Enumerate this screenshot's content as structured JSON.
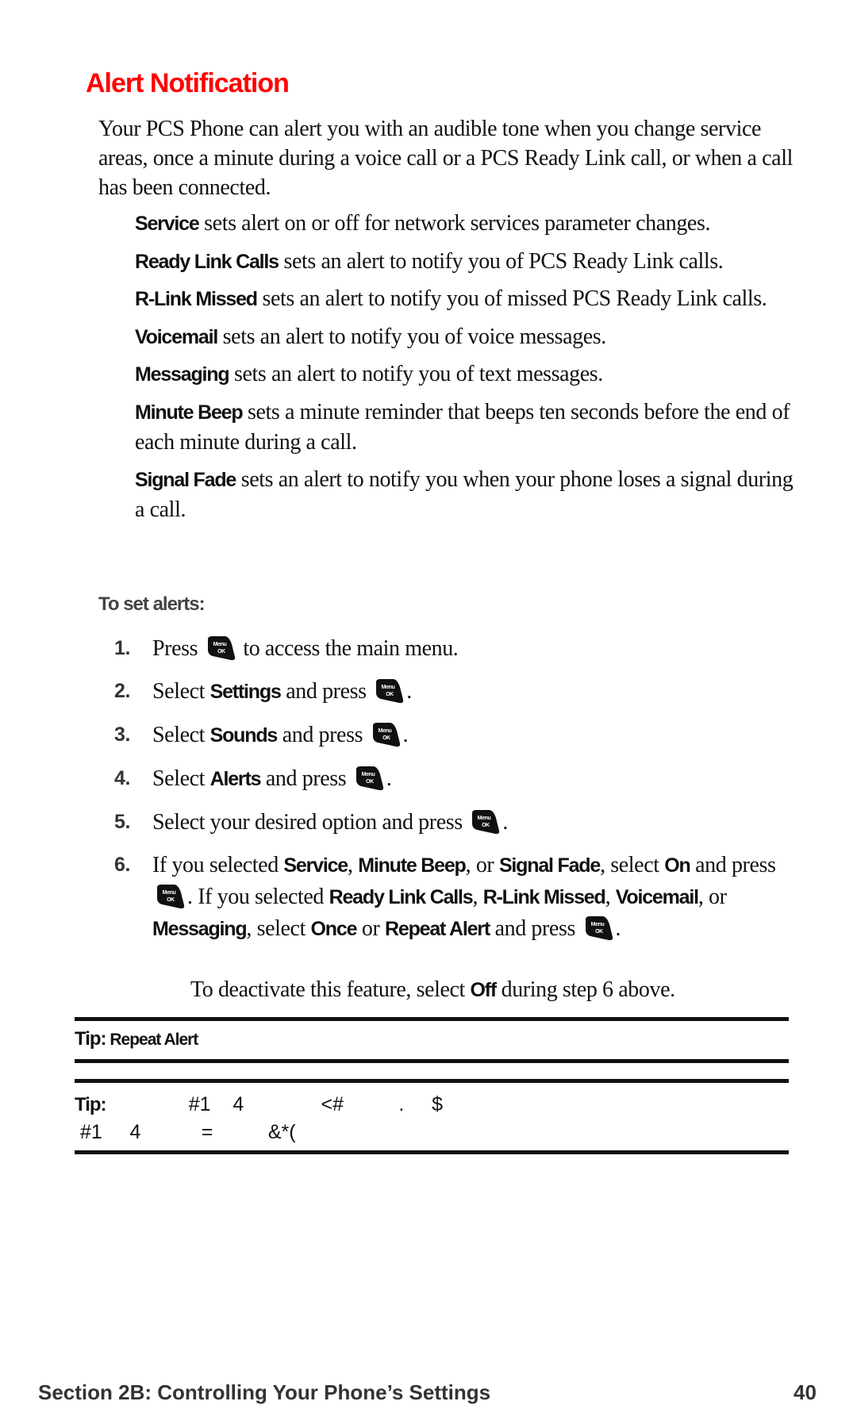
{
  "title": "Alert Notification",
  "intro": "Your PCS Phone can alert you with an audible tone when you change service areas, once a minute during a voice call or a PCS Ready Link call, or when a call has been connected.",
  "definitions": [
    {
      "term": "Service",
      "text": " sets alert on or off for network services parameter changes."
    },
    {
      "term": "Ready Link Calls",
      "text": " sets an alert to notify you of PCS Ready Link calls."
    },
    {
      "term": "R-Link Missed",
      "text": " sets an alert to notify you of missed PCS Ready Link calls."
    },
    {
      "term": "Voicemail",
      "text": " sets an alert to notify you of voice messages."
    },
    {
      "term": "Messaging",
      "text": " sets an alert to notify you of text messages."
    },
    {
      "term": "Minute Beep",
      "text": " sets a minute reminder that beeps ten seconds before the end of each minute during a call."
    },
    {
      "term": "Signal Fade",
      "text": " sets an alert to notify you when your phone loses a signal during a call."
    }
  ],
  "procedure_heading": "To set alerts:",
  "steps": {
    "s1": {
      "num": "1.",
      "a": "Press ",
      "b": " to access the main menu."
    },
    "s2": {
      "num": "2.",
      "a": "Select ",
      "k1": "Settings",
      "b": " and press ",
      "c": "."
    },
    "s3": {
      "num": "3.",
      "a": "Select ",
      "k1": "Sounds",
      "b": " and press ",
      "c": "."
    },
    "s4": {
      "num": "4.",
      "a": "Select ",
      "k1": "Alerts",
      "b": " and press ",
      "c": "."
    },
    "s5": {
      "num": "5.",
      "a": "Select your desired option and press ",
      "c": "."
    },
    "s6": {
      "num": "6.",
      "t1": "If you selected ",
      "k1": "Service",
      "t2": ", ",
      "k2": "Minute Beep",
      "t3": ", or ",
      "k3": "Signal Fade",
      "t4": ", select ",
      "k4": "On",
      "t5": " and press ",
      "t6": ". If you selected ",
      "k5": "Ready Link Calls",
      "t7": ", ",
      "k6": "R-Link Missed",
      "t8": ", ",
      "k7": "Voicemail",
      "t9": ", or ",
      "k8": "Messaging",
      "t10": ", select ",
      "k9": "Once",
      "t11": " or ",
      "k10": "Repeat Alert",
      "t12": " and press ",
      "t13": "."
    }
  },
  "note": {
    "a": "To deactivate this feature, select ",
    "k": "Off",
    "b": " during step 6 above."
  },
  "tips": [
    {
      "label": "Tip:",
      "text": " Repeat Alert"
    },
    {
      "label": "Tip:",
      "line1": "               #1    4              <#          .     $",
      "line2": " #1     4           =          &*("
    }
  ],
  "icons": {
    "menu_key": "menu-ok-key"
  },
  "footer": {
    "section": "Section 2B: Controlling Your Phone’s Settings",
    "page": "40"
  },
  "colors": {
    "title": "#ff0000",
    "text": "#111111",
    "subhead": "#444444"
  }
}
